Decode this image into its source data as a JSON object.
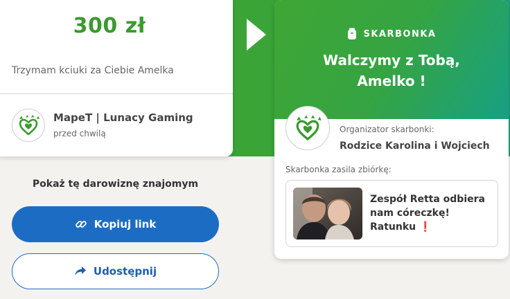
{
  "donation": {
    "amount": "300 zł",
    "message": "Trzymam kciuki za Ciebie Amelka",
    "donor_name": "MapeT | Lunacy Gaming",
    "donor_time": "przed chwilą",
    "logo_icon": "heart-paw-logo-icon"
  },
  "share": {
    "title": "Pokaż tę darowiznę znajomym",
    "copy_label": "Kopiuj link",
    "copy_icon": "link-icon",
    "share_label": "Udostępnij",
    "share_icon": "share-arrow-icon"
  },
  "piggybank": {
    "label": "SKARBONKA",
    "label_icon": "piggy-bank-jar-icon",
    "title_line1": "Walczymy z Tobą,",
    "title_line2": "Amelko !",
    "organizer_label": "Organizator skarbonki:",
    "organizer_name": "Rodzice Karolina i Wojciech",
    "supports_label": "Skarbonka zasila zbiórkę:",
    "campaign_title": "Zespół Retta odbiera nam córeczkę! Ratunku",
    "campaign_emoji": "❗"
  },
  "colors": {
    "brand_green": "#3a9a2e",
    "primary_blue": "#1d6cc4",
    "background": "#f4f2ef"
  }
}
